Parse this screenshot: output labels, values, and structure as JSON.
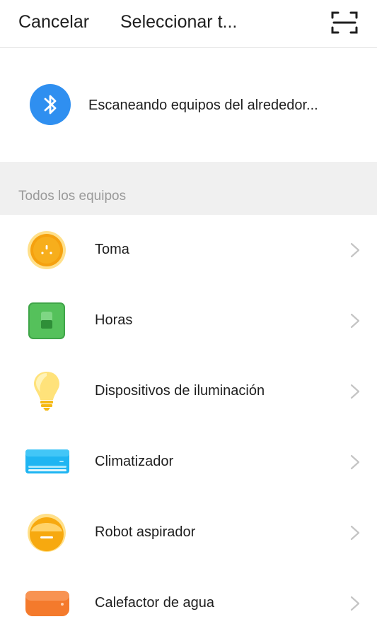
{
  "header": {
    "cancel_label": "Cancelar",
    "title": "Seleccionar t...",
    "scan_icon": "scan-icon"
  },
  "scan": {
    "icon": "bluetooth-icon",
    "text": "Escaneando equipos del alrededor..."
  },
  "section": {
    "label": "Todos los equipos"
  },
  "devices": [
    {
      "label": "Toma",
      "icon": "socket-icon"
    },
    {
      "label": "Horas",
      "icon": "switch-icon"
    },
    {
      "label": "Dispositivos de iluminación",
      "icon": "light-bulb-icon"
    },
    {
      "label": "Climatizador",
      "icon": "air-conditioner-icon"
    },
    {
      "label": "Robot aspirador",
      "icon": "robot-vacuum-icon"
    },
    {
      "label": "Calefactor de agua",
      "icon": "water-heater-icon"
    }
  ],
  "colors": {
    "bluetooth": "#2f8ff0",
    "socket": "#f5a10f",
    "switch": "#55c15b",
    "bulb": "#ffe27a",
    "air_conditioner": "#1fb5f2",
    "vacuum": "#f7a90f",
    "water_heater": "#f47a2c",
    "section_bg": "#f0f0f0"
  }
}
